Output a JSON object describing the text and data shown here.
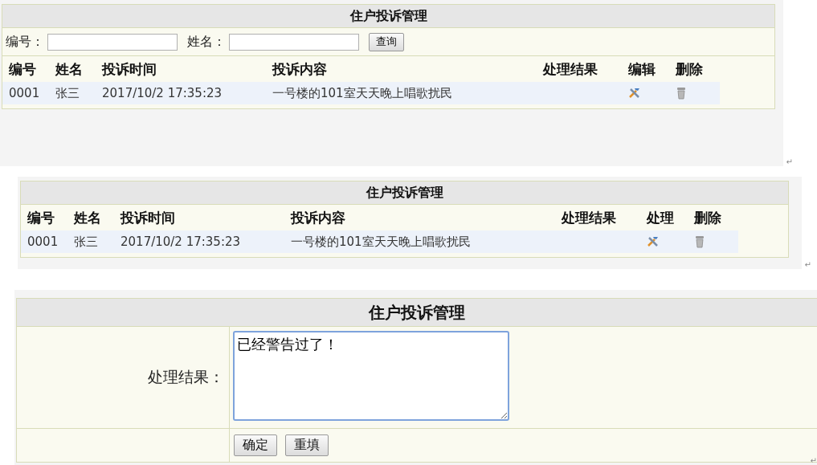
{
  "panels": [
    {
      "kind": "list",
      "title": "住户投诉管理",
      "search": {
        "fields": [
          {
            "label": "编号："
          },
          {
            "label": "姓名："
          }
        ],
        "button": "查询"
      },
      "columns": [
        "编号",
        "姓名",
        "投诉时间",
        "投诉内容",
        "处理结果",
        "编辑",
        "删除"
      ],
      "rows": [
        {
          "cells": [
            "0001",
            "张三",
            "2017/10/2 17:35:23",
            "一号楼的101室天天晚上唱歌扰民",
            ""
          ]
        }
      ],
      "mark": "↵"
    },
    {
      "kind": "list",
      "title": "住户投诉管理",
      "columns": [
        "编号",
        "姓名",
        "投诉时间",
        "投诉内容",
        "处理结果",
        "处理",
        "删除"
      ],
      "rows": [
        {
          "cells": [
            "0001",
            "张三",
            "2017/10/2 17:35:23",
            "一号楼的101室天天晚上唱歌扰民",
            ""
          ]
        }
      ],
      "mark": "↵"
    },
    {
      "kind": "form",
      "title": "住户投诉管理",
      "field_label": "处理结果：",
      "field_value": "已经警告过了！",
      "buttons": [
        "确定",
        "重填"
      ],
      "mark": "↵"
    }
  ]
}
